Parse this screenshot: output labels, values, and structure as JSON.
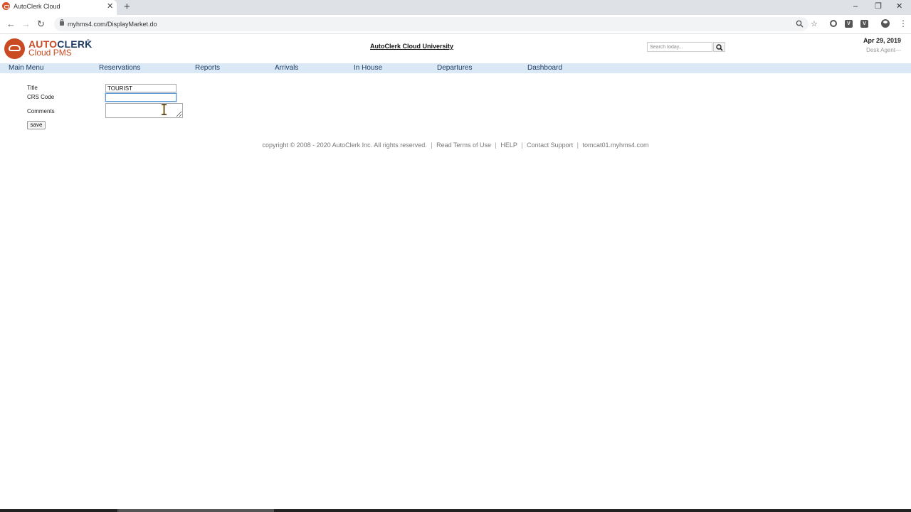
{
  "browser": {
    "tab_title": "AutoClerk Cloud",
    "tab_close": "✕",
    "new_tab": "+",
    "url": "myhms4.com/DisplayMarket.do",
    "window_controls": {
      "minimize": "–",
      "restore": "❐",
      "close": "✕"
    },
    "ext_label": "V"
  },
  "header": {
    "logo_auto": "AUTO",
    "logo_clerk": "CLERK",
    "logo_tm": "®",
    "logo_sub": "Cloud PMS",
    "university": "AutoClerk Cloud University",
    "search_placeholder": "Search today...",
    "date": "Apr 29, 2019",
    "user": "Desk Agent---"
  },
  "nav": {
    "items": [
      "Main Menu",
      "Reservations",
      "Reports",
      "Arrivals",
      "In House",
      "Departures",
      "Dashboard"
    ]
  },
  "form": {
    "title_label": "Title",
    "title_value": "TOURIST",
    "crs_label": "CRS Code",
    "crs_value": "",
    "comments_label": "Comments",
    "comments_value": "",
    "save_label": "save"
  },
  "footer": {
    "copyright": "copyright © 2008 - 2020 AutoClerk Inc. All rights reserved.",
    "terms": "Read Terms of Use",
    "help": "HELP",
    "support": "Contact Support",
    "server": "tomcat01.myhms4.com",
    "separator": "|"
  },
  "colors": {
    "brand_orange": "#c94a23",
    "brand_navy": "#1f3d63",
    "nav_bg": "#dbe8f6"
  }
}
